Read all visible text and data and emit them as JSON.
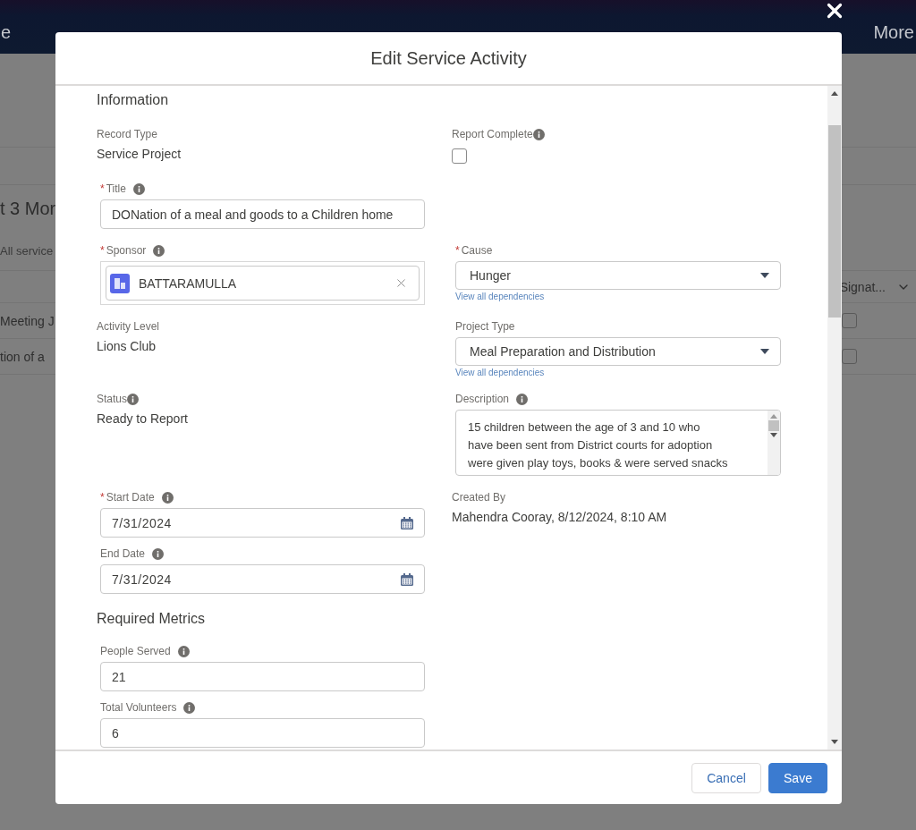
{
  "background": {
    "nav": [
      {
        "label": "e"
      },
      {
        "label": "More"
      }
    ],
    "heading": "t 3 Mor",
    "subtext": "All service",
    "column_header": "Signat...",
    "rows": [
      {
        "text": "Meeting J",
        "checked": false
      },
      {
        "text": "tion of a",
        "checked": false
      }
    ]
  },
  "modal": {
    "title": "Edit Service Activity",
    "sections": [
      {
        "title": "Information",
        "rows": [
          {
            "left": [
              {
                "kind": "readonly",
                "label": "Record Type",
                "value": "Service Project"
              }
            ],
            "right": [
              {
                "kind": "checkbox",
                "label": "Report Complete",
                "info": true,
                "checked": false
              }
            ]
          },
          {
            "left": [
              {
                "kind": "text",
                "label": "Title",
                "marker": "*",
                "info": true,
                "value": "DONation of a meal and goods to a Children home"
              }
            ],
            "right": []
          },
          {
            "left": [
              {
                "kind": "lookup",
                "label": "Sponsor",
                "marker": "*",
                "info": true,
                "value": "BATTARAMULLA"
              }
            ],
            "right": [
              {
                "kind": "picklist",
                "label": "Cause",
                "marker": "*",
                "value": "Hunger",
                "link": "View all dependencies"
              }
            ]
          },
          {
            "left": [
              {
                "kind": "readonly",
                "label": "Activity Level",
                "value": "Lions Club"
              }
            ],
            "right": [
              {
                "kind": "picklist",
                "label": "Project Type",
                "value": "Meal Preparation and Distribution",
                "link": "View all dependencies"
              }
            ]
          },
          {
            "left": [
              {
                "kind": "readonly",
                "label": "Status",
                "value": "Ready to Report",
                "info": true
              }
            ],
            "right": [
              {
                "kind": "textarea",
                "label": "Description",
                "info": true,
                "value": "15 children between the age of 3 and 10 who have been sent from District courts for adoption were given play toys, books & were served snacks"
              }
            ]
          },
          {
            "left": [
              {
                "kind": "date",
                "label": "Start Date",
                "marker": "*",
                "info": true,
                "value": "7/31/2024"
              },
              {
                "kind": "date",
                "label": "End Date",
                "info": true,
                "value": "7/31/2024"
              }
            ],
            "right": [
              {
                "kind": "readonly",
                "label": "Created By",
                "value": "Mahendra Cooray, 8/12/2024, 8:10 AM"
              }
            ]
          }
        ]
      },
      {
        "title": "Required Metrics",
        "rows": [
          {
            "left": [
              {
                "kind": "text",
                "label": "People Served",
                "info": true,
                "value": "21"
              },
              {
                "kind": "text",
                "label": "Total Volunteers",
                "info": true,
                "value": "6"
              }
            ],
            "right": []
          }
        ]
      }
    ],
    "buttons": [
      {
        "label": "Cancel",
        "kind": "neutral"
      },
      {
        "label": "Save",
        "kind": "brand"
      }
    ]
  }
}
